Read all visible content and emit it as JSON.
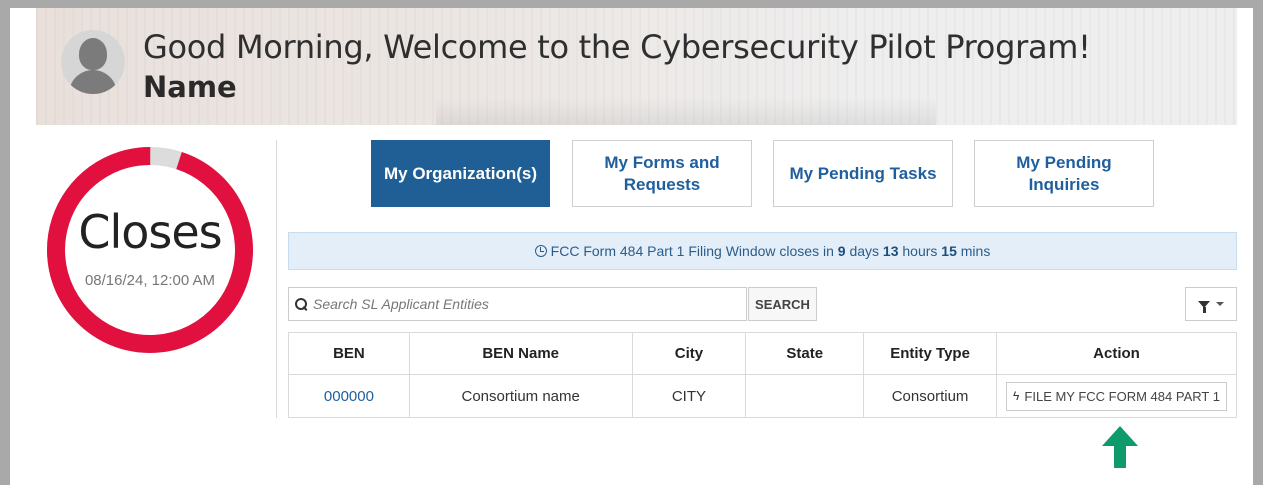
{
  "banner": {
    "greeting": "Good Morning, Welcome to the Cybersecurity Pilot Program!",
    "user_name": "Name"
  },
  "countdown": {
    "label": "Closes",
    "date": "08/16/24, 12:00 AM",
    "fraction_remaining": 0.95,
    "ring_color": "#e2103f",
    "track_color": "#dcdcdc"
  },
  "tabs": [
    {
      "label": "My Organization(s)",
      "active": true
    },
    {
      "label": "My Forms and Requests",
      "active": false
    },
    {
      "label": "My Pending Tasks",
      "active": false
    },
    {
      "label": "My Pending Inquiries",
      "active": false
    }
  ],
  "notice": {
    "prefix": "FCC Form 484 Part 1 Filing Window closes in",
    "days": "9",
    "days_label": "days",
    "hours": "13",
    "hours_label": "hours",
    "mins": "15",
    "mins_label": "mins"
  },
  "search": {
    "placeholder": "Search SL Applicant Entities",
    "button_label": "SEARCH"
  },
  "filter": {
    "icon": "filter-icon"
  },
  "table": {
    "headers": [
      "BEN",
      "BEN Name",
      "City",
      "State",
      "Entity Type",
      "Action"
    ],
    "rows": [
      {
        "ben": "000000",
        "ben_name": "Consortium name",
        "city": "CITY",
        "state": "",
        "entity_type": "Consortium",
        "action": "FILE MY FCC FORM 484 PART 1"
      }
    ]
  },
  "colors": {
    "primary": "#205e96",
    "accent_green": "#0e9a6a"
  }
}
